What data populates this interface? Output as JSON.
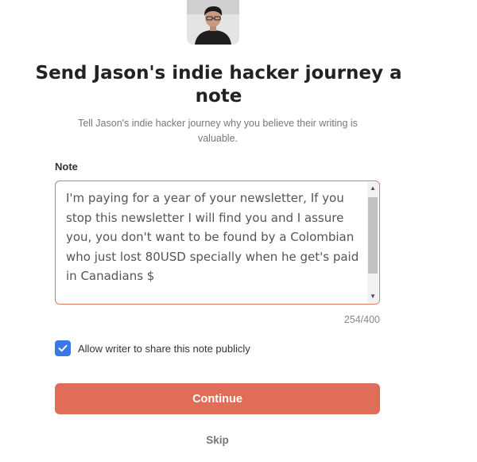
{
  "header": {
    "avatar_icon": "user-photo",
    "title": "Send Jason's indie hacker journey a note",
    "subtitle": "Tell Jason's indie hacker journey why you believe their writing is valuable."
  },
  "form": {
    "note_label": "Note",
    "note_value": "I'm paying for a year of your newsletter, If you stop this newsletter I will find you and I assure you, you don't want to be found by a Colombian who just lost  80USD specially when he get's paid in Canadians $",
    "char_count": "254/400",
    "share_checked": true,
    "share_label": "Allow writer to share this note publicly"
  },
  "actions": {
    "continue_label": "Continue",
    "skip_label": "Skip"
  },
  "colors": {
    "accent": "#e06d58",
    "checkbox": "#3b78e7",
    "border": "#d47a6a"
  }
}
